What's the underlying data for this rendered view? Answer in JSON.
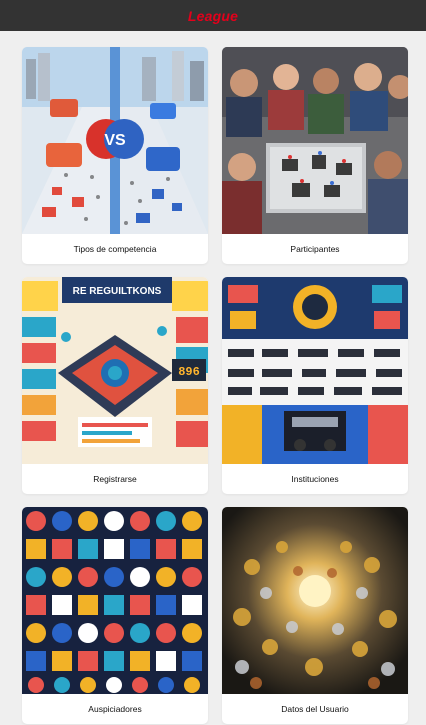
{
  "header": {
    "brand": "League"
  },
  "cards": [
    {
      "label": "Tipos de competencia",
      "image": "competition-types-illustration"
    },
    {
      "label": "Participantes",
      "image": "participants-photo"
    },
    {
      "label": "Registrarse",
      "image": "registration-infographic"
    },
    {
      "label": "Instituciones",
      "image": "institutions-sponsor-board"
    },
    {
      "label": "Auspiciadores",
      "image": "sponsors-badges-collage"
    },
    {
      "label": "Datos del Usuario",
      "image": "user-data-trophies"
    }
  ],
  "colors": {
    "header_bg": "#333333",
    "brand": "#e3001b",
    "page_bg": "#efefef",
    "card_bg": "#ffffff"
  },
  "thumb_text": {
    "vs": "VS",
    "reg_title": "RE REGUILTKONS",
    "reg_number": "896"
  }
}
